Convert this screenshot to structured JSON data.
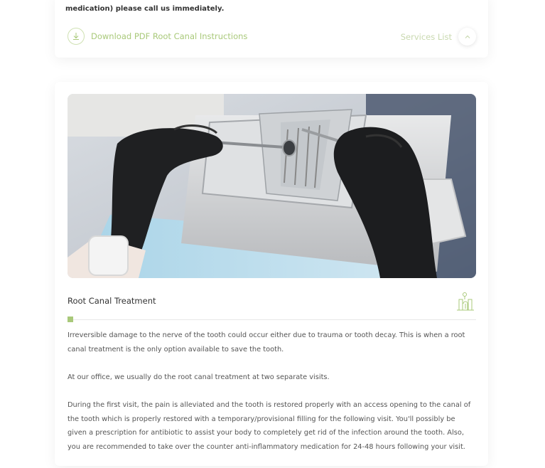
{
  "top_card": {
    "text_line2": "medication) please call us immediately.",
    "download_label": "Download PDF Root Canal Instructions",
    "services_label": "Services List"
  },
  "main_card": {
    "title": "Root Canal Treatment",
    "paragraphs": [
      "Irreversible damage to the nerve of the tooth could occur either due to trauma or tooth decay. This is when a root canal treatment is the only option available to save the tooth.",
      "At our office, we usually do the root canal treatment at two separate visits.",
      "During the first visit, the pain is alleviated and the tooth is restored properly with an access opening to the canal of the tooth which is properly restored with a temporary/provisional filling for the following visit. You'll possibly be given a prescription for antibiotic to assist your body to completely get rid of the infection around the tooth.  Also, you are recommended to take over the counter anti-inflammatory medication for 24-48 hours following your visit."
    ]
  },
  "colors": {
    "accent": "#a9c97a",
    "muted_accent": "#c9d9b0",
    "text": "#555555"
  }
}
